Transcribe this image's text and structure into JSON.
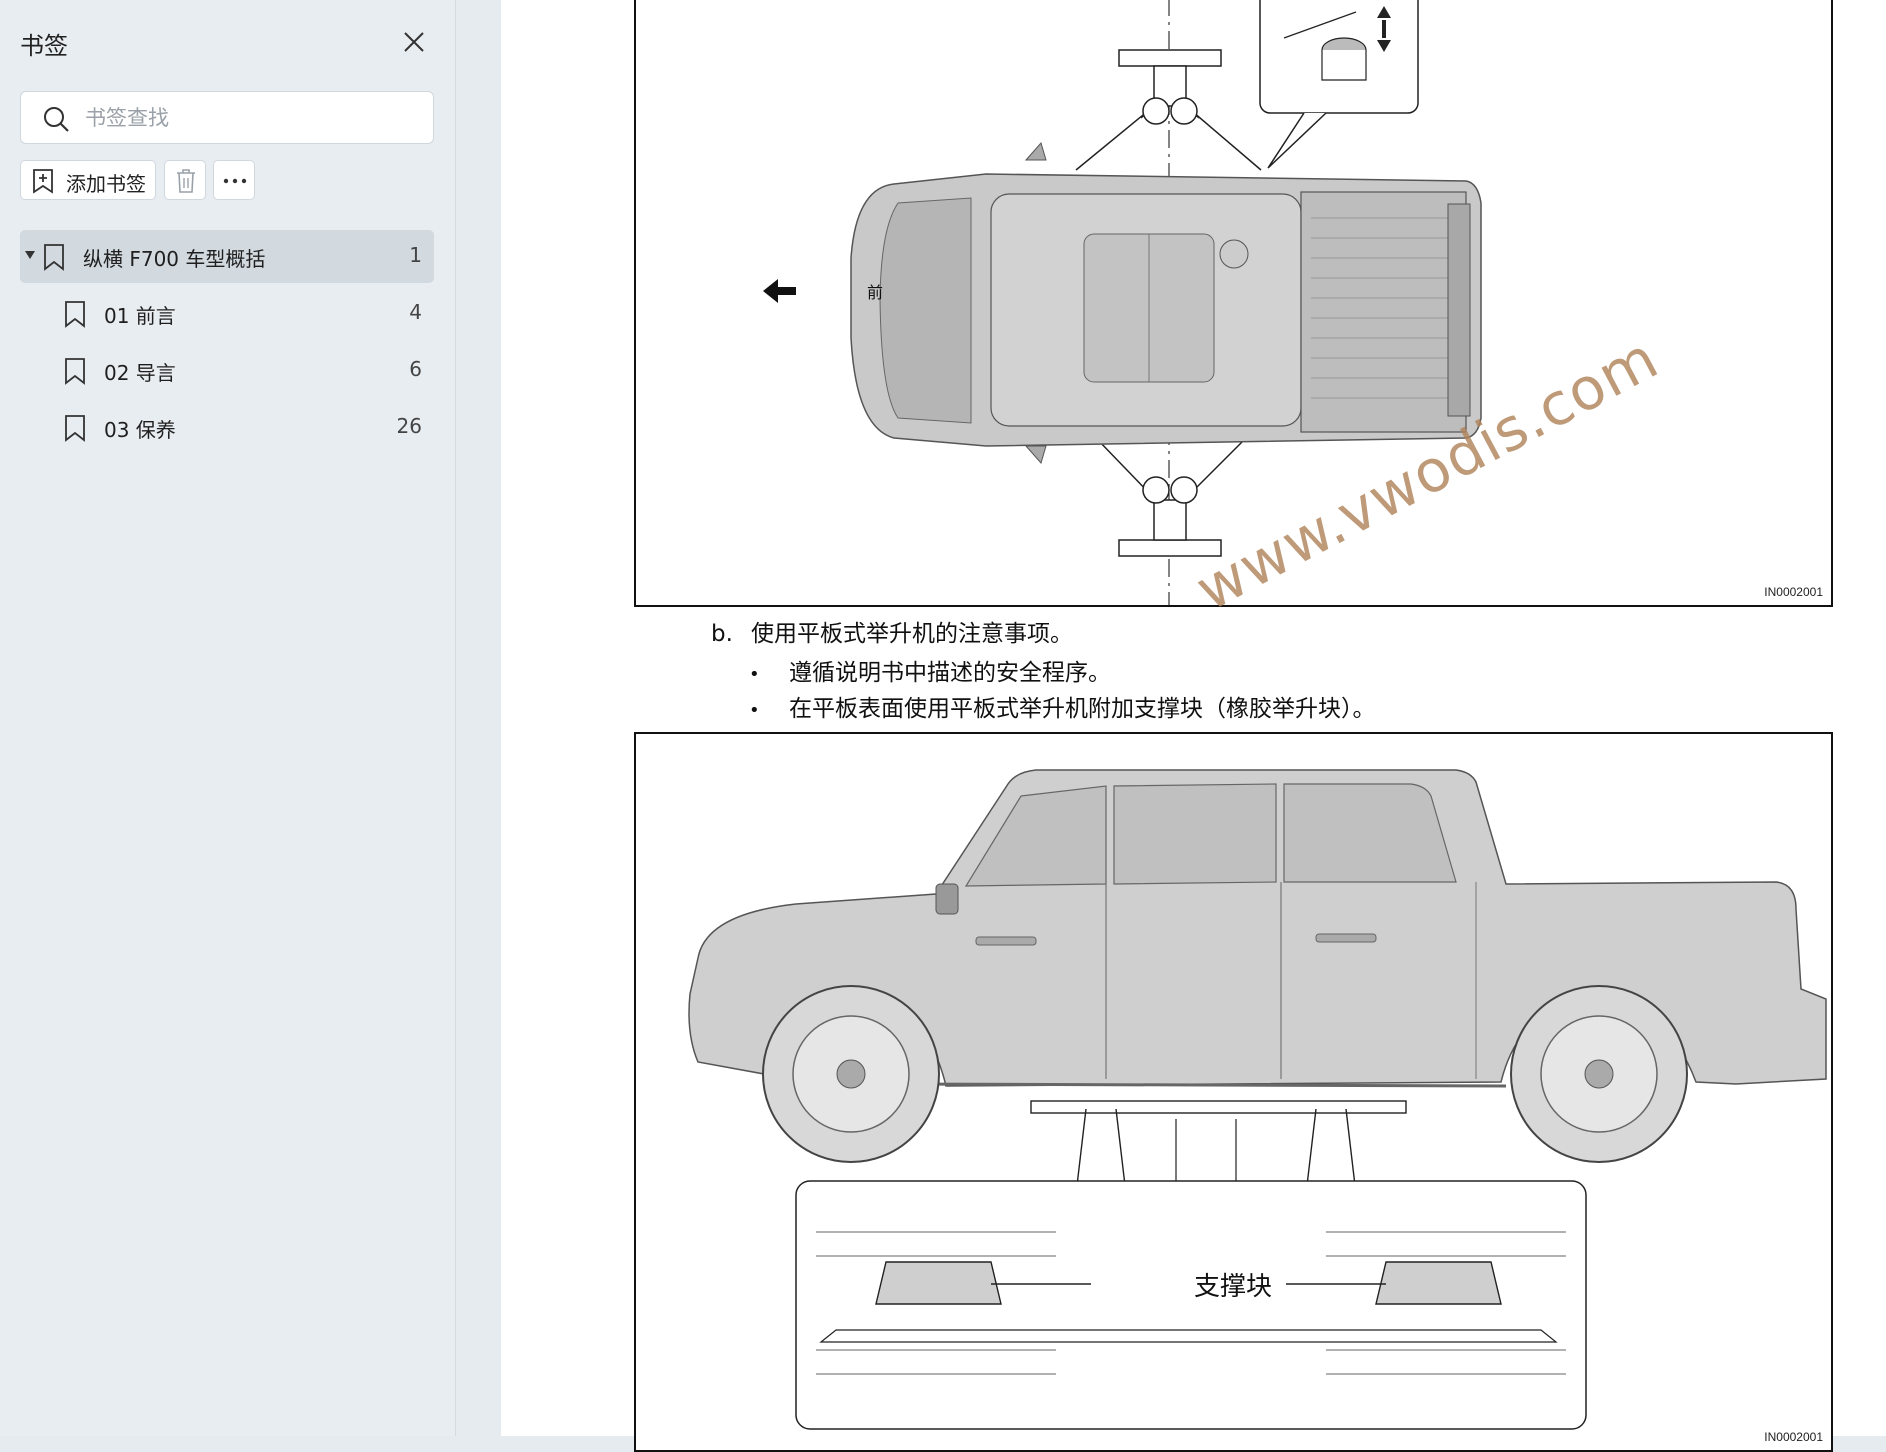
{
  "sidebar": {
    "title": "书签",
    "search_placeholder": "书签查找",
    "add_label": "添加书签",
    "items": [
      {
        "label": "纵横 F700 车型概括",
        "page": "1",
        "level": 0,
        "expanded": true,
        "active": true
      },
      {
        "label": "01 前言",
        "page": "4",
        "level": 1
      },
      {
        "label": "02 导言",
        "page": "6",
        "level": 1
      },
      {
        "label": "03 保养",
        "page": "26",
        "level": 1
      }
    ]
  },
  "document": {
    "figure_top": {
      "front_label": "前",
      "figure_id": "IN0002001"
    },
    "section_b": {
      "marker": "b.",
      "heading": "使用平板式举升机的注意事项。",
      "bullets": [
        "遵循说明书中描述的安全程序。",
        "在平板表面使用平板式举升机附加支撑块（橡胶举升块）。"
      ]
    },
    "figure_bottom": {
      "block_label": "支撑块",
      "figure_id": "IN0002001"
    },
    "watermark": "www.vwodis.com"
  },
  "colors": {
    "sidebar_bg": "#e8edf1",
    "active_item": "#d2d9df",
    "watermark": "#b0845a"
  }
}
